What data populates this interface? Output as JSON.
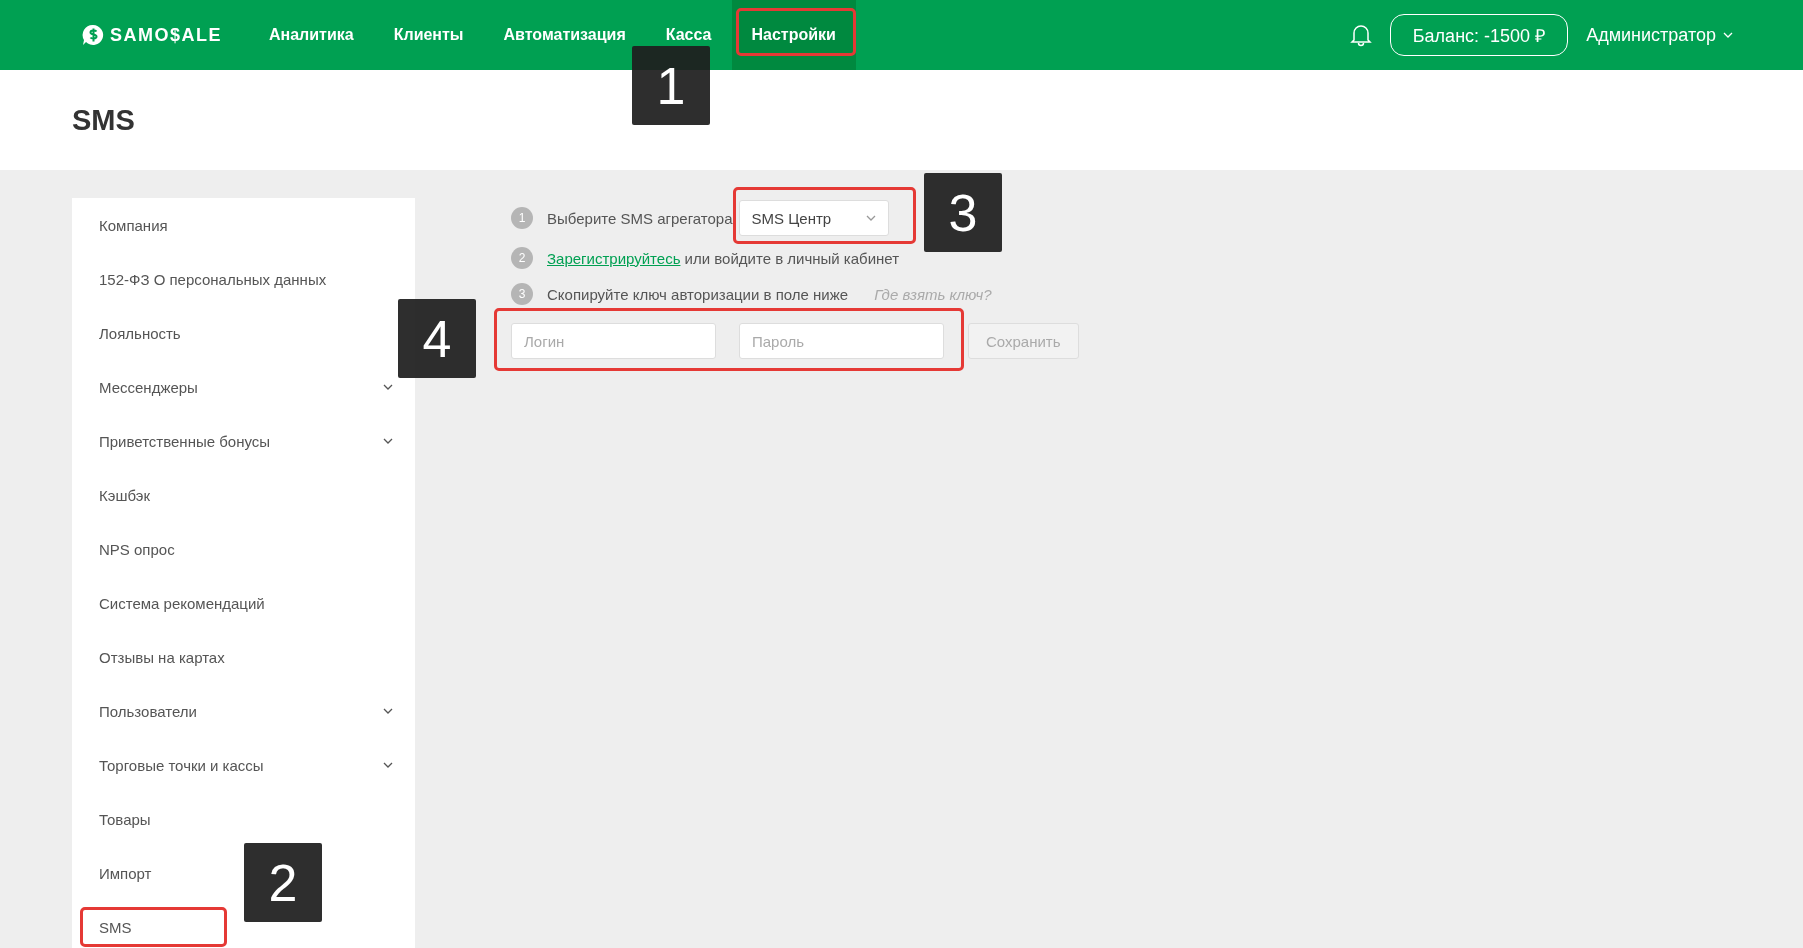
{
  "header": {
    "logo": "SAMO$ALE",
    "nav": [
      {
        "label": "Аналитика",
        "selected": false
      },
      {
        "label": "Клиенты",
        "selected": false
      },
      {
        "label": "Автоматизация",
        "selected": false
      },
      {
        "label": "Касса",
        "selected": false
      },
      {
        "label": "Настройки",
        "selected": true
      }
    ],
    "balance": "Баланс: -1500 ₽",
    "user": "Администратор"
  },
  "page_title": "SMS",
  "sidebar": {
    "items": [
      {
        "label": "Компания",
        "has_submenu": false
      },
      {
        "label": "152-ФЗ О персональных данных",
        "has_submenu": false
      },
      {
        "label": "Лояльность",
        "has_submenu": false
      },
      {
        "label": "Мессенджеры",
        "has_submenu": true
      },
      {
        "label": "Приветственные бонусы",
        "has_submenu": true
      },
      {
        "label": "Кэшбэк",
        "has_submenu": false
      },
      {
        "label": "NPS опрос",
        "has_submenu": false
      },
      {
        "label": "Система рекомендаций",
        "has_submenu": false
      },
      {
        "label": "Отзывы на картах",
        "has_submenu": false
      },
      {
        "label": "Пользователи",
        "has_submenu": true
      },
      {
        "label": "Торговые точки и кассы",
        "has_submenu": true
      },
      {
        "label": "Товары",
        "has_submenu": false
      },
      {
        "label": "Импорт",
        "has_submenu": false
      },
      {
        "label": "SMS",
        "has_submenu": false
      }
    ]
  },
  "setup": {
    "steps": [
      {
        "number": "1",
        "text": "Выберите SMS агрегатора"
      },
      {
        "number": "2",
        "link": "Зарегистрируйтесь",
        "text": " или войдите в личный кабинет"
      },
      {
        "number": "3",
        "text": "Скопируйте ключ авторизации в поле ниже",
        "help": "Где взять ключ?"
      }
    ],
    "aggregator": "SMS Центр",
    "login": {
      "placeholder": "Логин"
    },
    "password": {
      "placeholder": "Пароль"
    },
    "save": {
      "label": "Сохранить",
      "disabled": true
    }
  },
  "annotations": [
    {
      "label": "1"
    },
    {
      "label": "2"
    },
    {
      "label": "3"
    },
    {
      "label": "4"
    }
  ]
}
